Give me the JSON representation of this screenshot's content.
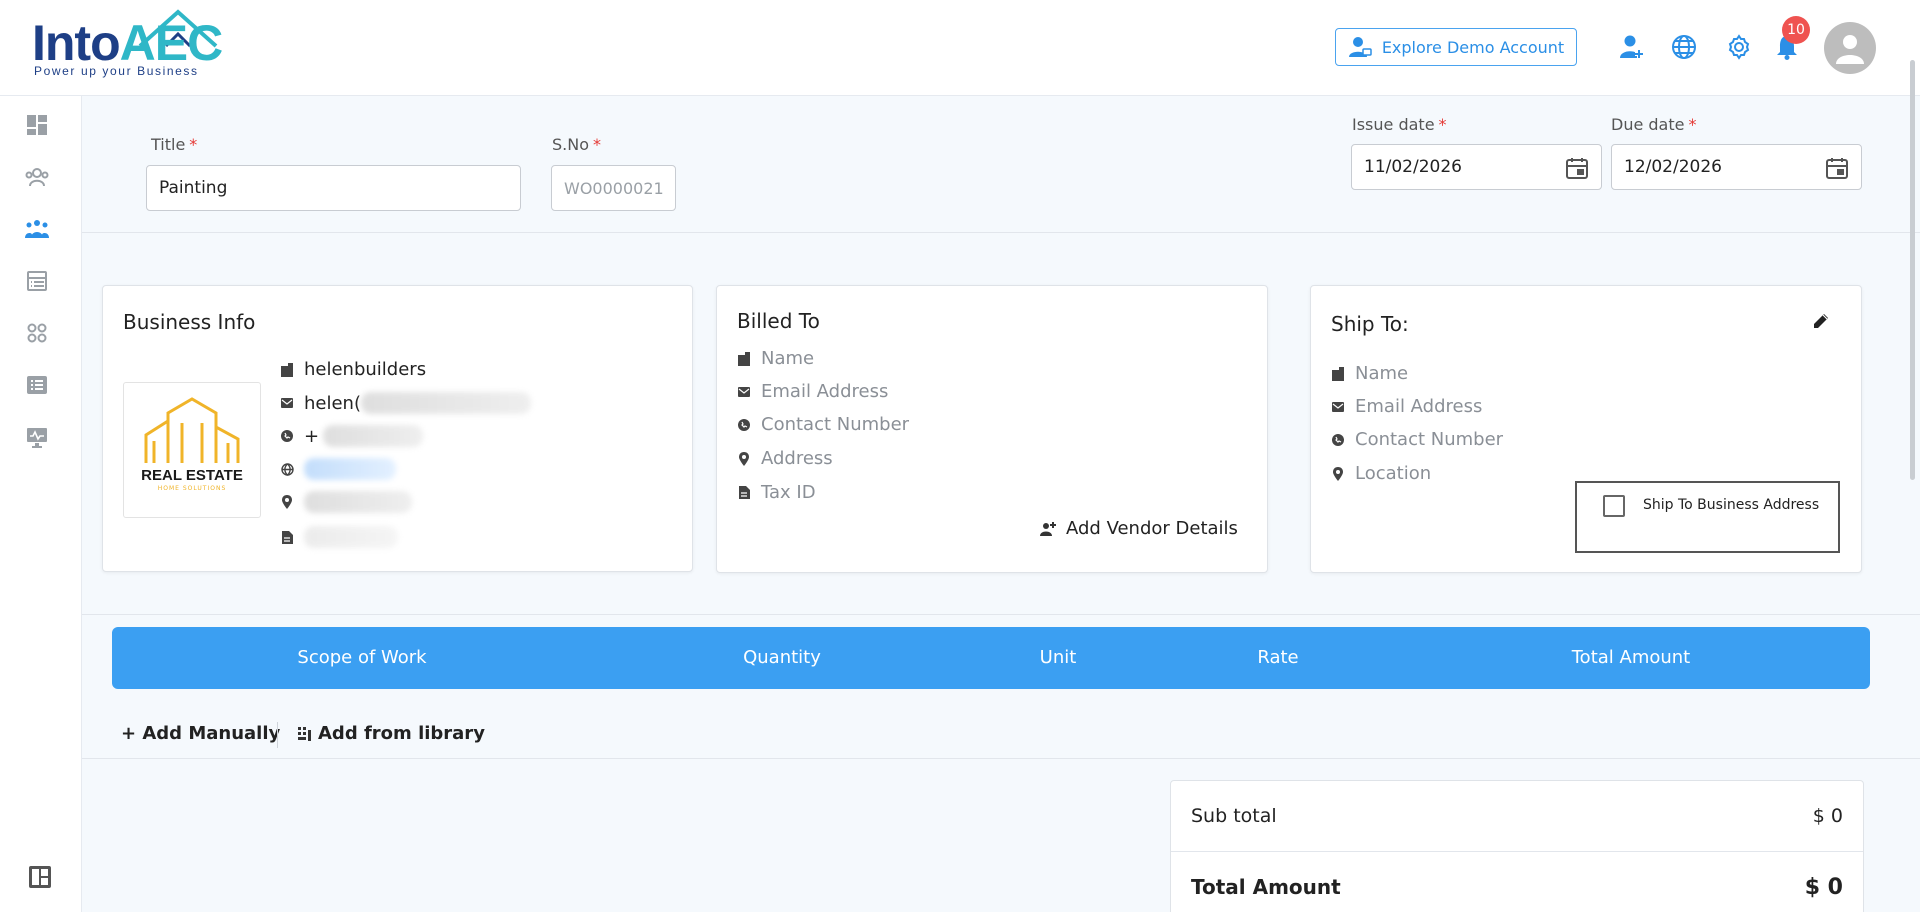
{
  "header": {
    "logo_into": "Into",
    "logo_aec": "AEC",
    "logo_tagline": "Power up your Business",
    "demo_button": "Explore Demo Account",
    "notification_count": "10",
    "icons": [
      "add-user-icon",
      "globe-icon",
      "gear-icon",
      "bell-icon",
      "avatar-icon"
    ]
  },
  "sidebar": {
    "items": [
      "dashboard-icon",
      "clients-icon",
      "team-icon",
      "store-icon",
      "modules-icon",
      "list-icon",
      "monitor-icon"
    ],
    "bottom": "layout-icon"
  },
  "form": {
    "title_label": "Title",
    "title_value": "Painting",
    "sno_label": "S.No",
    "sno_placeholder": "WO0000021",
    "issue_label": "Issue date",
    "issue_value": "11/02/2026",
    "due_label": "Due date",
    "due_value": "12/02/2026",
    "required_mark": "*"
  },
  "business": {
    "heading": "Business Info",
    "name": "helenbuilders",
    "email_prefix": "helen(",
    "phone_prefix": "+",
    "logo_title": "REAL ESTATE",
    "logo_subtitle": "HOME SOLUTIONS"
  },
  "billed": {
    "heading": "Billed To",
    "name": "Name",
    "email": "Email Address",
    "contact": "Contact Number",
    "address": "Address",
    "tax": "Tax ID",
    "add_vendor": "Add Vendor Details"
  },
  "ship": {
    "heading": "Ship To:",
    "name": "Name",
    "email": "Email Address",
    "contact": "Contact Number",
    "location": "Location",
    "checkbox_label": "Ship To Business Address"
  },
  "table": {
    "columns": [
      "Scope of Work",
      "Quantity",
      "Unit",
      "Rate",
      "Total Amount"
    ],
    "add_manually": "+ Add Manually",
    "add_library": "Add from library"
  },
  "totals": {
    "subtotal_label": "Sub total",
    "subtotal_value": "$ 0",
    "total_label": "Total Amount",
    "total_value": "$ 0"
  },
  "colors": {
    "primary": "#3b9ff2",
    "brand_dark": "#1e3f86",
    "brand_teal": "#2fb7c7",
    "badge": "#ef5350",
    "required": "#e53935"
  }
}
